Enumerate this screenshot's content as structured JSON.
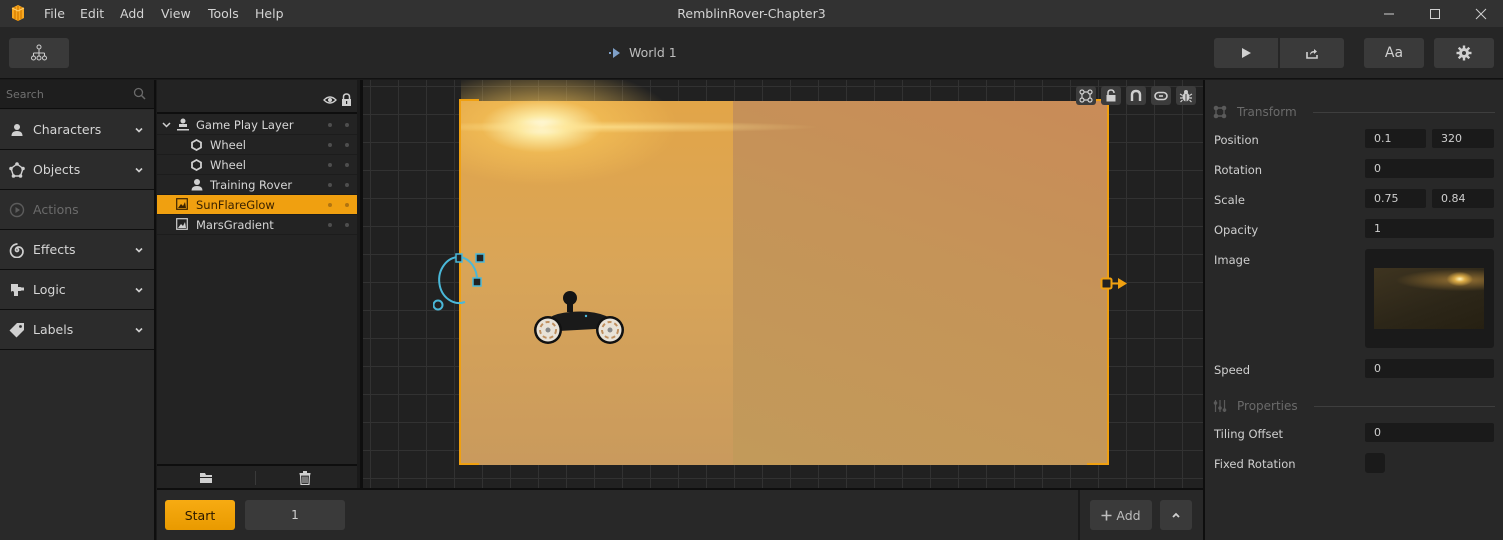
{
  "window": {
    "title": "RemblinRover-Chapter3",
    "menu": [
      "File",
      "Edit",
      "Add",
      "View",
      "Tools",
      "Help"
    ],
    "controls": [
      "minimize",
      "maximize",
      "close"
    ]
  },
  "toolbar": {
    "hierarchy_icon": "hierarchy-icon",
    "breadcrumb": "World 1",
    "play_icon": "play-icon",
    "share_icon": "share-icon",
    "font_label": "Aa",
    "settings_icon": "gear-icon"
  },
  "library": {
    "search_placeholder": "Search",
    "categories": [
      {
        "label": "Characters",
        "icon": "person-icon",
        "enabled": true
      },
      {
        "label": "Objects",
        "icon": "objects-icon",
        "enabled": true
      },
      {
        "label": "Actions",
        "icon": "play-circle-icon",
        "enabled": false
      },
      {
        "label": "Effects",
        "icon": "spiral-icon",
        "enabled": true
      },
      {
        "label": "Logic",
        "icon": "puzzle-icon",
        "enabled": true
      },
      {
        "label": "Labels",
        "icon": "tag-icon",
        "enabled": true
      }
    ]
  },
  "layers": {
    "rows": [
      {
        "label": "Game Play Layer",
        "icon": "layer-icon",
        "expanded": true,
        "selected": false
      },
      {
        "label": "Wheel",
        "icon": "hexagon-icon",
        "selected": false
      },
      {
        "label": "Wheel",
        "icon": "hexagon-icon",
        "selected": false
      },
      {
        "label": "Training Rover",
        "icon": "person-icon",
        "selected": false
      },
      {
        "label": "SunFlareGlow",
        "icon": "image-icon",
        "selected": true
      },
      {
        "label": "MarsGradient",
        "icon": "image-icon",
        "selected": false
      }
    ]
  },
  "bottom_bar": {
    "start_label": "Start",
    "frame_value": "1",
    "add_label": "Add"
  },
  "inspector": {
    "transform_title": "Transform",
    "position_label": "Position",
    "position_x": "0.1",
    "position_y": "320",
    "rotation_label": "Rotation",
    "rotation": "0",
    "scale_label": "Scale",
    "scale_x": "0.75",
    "scale_y": "0.84",
    "opacity_label": "Opacity",
    "opacity": "1",
    "image_label": "Image",
    "speed_label": "Speed",
    "speed": "0",
    "properties_title": "Properties",
    "tiling_label": "Tiling Offset",
    "tiling": "0",
    "fixed_rotation_label": "Fixed Rotation",
    "fixed_rotation": false
  },
  "colors": {
    "accent": "#f0a010",
    "gizmo": "#4ab8d8"
  }
}
